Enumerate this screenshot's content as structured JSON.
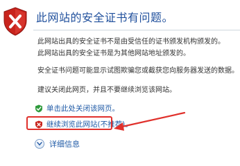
{
  "dialog": {
    "title": "此网站的安全证书有问题。",
    "para1_line1": "此网站出具的安全证书不是由受信任的证书颁发机构颁发的。",
    "para1_line2": "此网站出具的安全证书是为其他网站地址颁发的。",
    "para2": "安全证书问题可能显示试图欺骗您或截获您向服务器发送的数据。",
    "para3": "建议关闭此网页，并且不要继续浏览该网站。"
  },
  "actions": {
    "close_label": "单击此处关闭该网页。",
    "continue_label": "继续浏览此网站(不推荐)。",
    "more_info_label": "详细信息"
  },
  "colors": {
    "title": "#1f4f9c",
    "link": "#1f5aa6",
    "shield_red": "#c8241d",
    "annotation": "#e0302b"
  },
  "icons": {
    "header": "shield-x-icon",
    "close": "green-shield-check-icon",
    "continue": "red-shield-x-icon",
    "more_info": "chevron-down-circle-icon"
  }
}
